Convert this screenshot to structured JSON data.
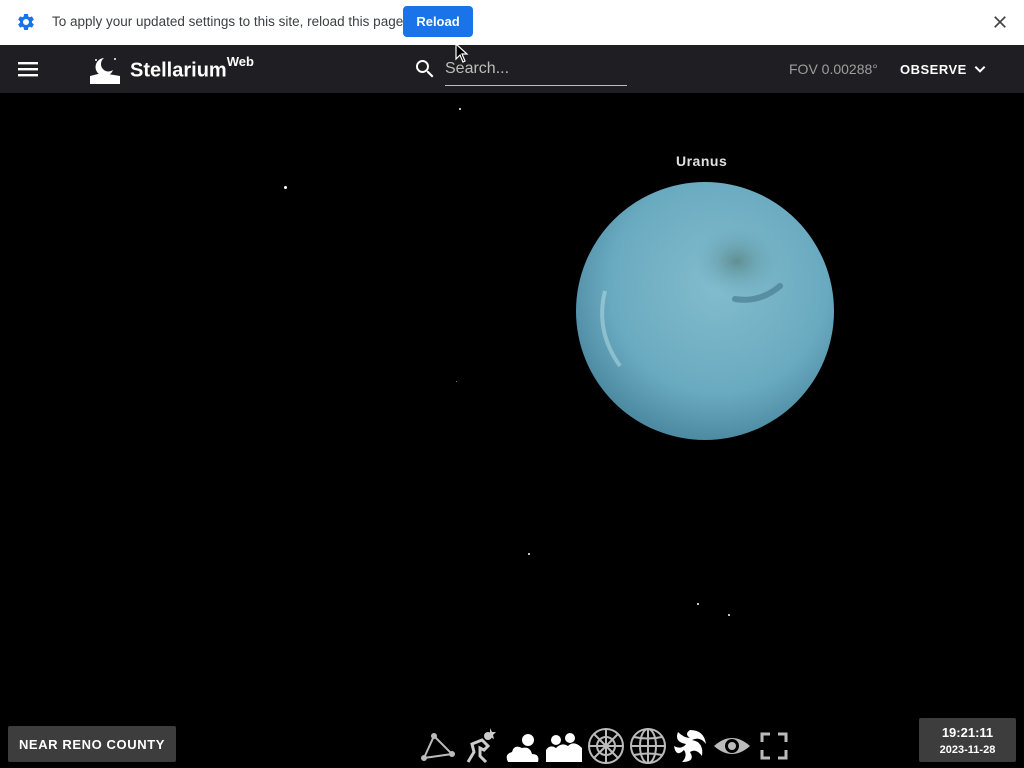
{
  "infobar": {
    "message": "To apply your updated settings to this site, reload this page",
    "reload_label": "Reload",
    "icons": {
      "settings": "gear-icon",
      "close": "close-icon"
    }
  },
  "app": {
    "brand": "Stellarium",
    "brand_sup": "Web",
    "search_placeholder": "Search...",
    "fov": "FOV 0.00288°",
    "observe_label": "OBSERVE"
  },
  "sky": {
    "planet_label": "Uranus"
  },
  "bottom": {
    "location": "NEAR RENO COUNTY",
    "time": "19:21:11",
    "date": "2023-11-28",
    "tools": [
      "constellation-lines-icon",
      "constellation-art-icon",
      "atmosphere-icon",
      "landscape-icon",
      "azimuthal-grid-icon",
      "equatorial-grid-icon",
      "deep-sky-icon",
      "night-mode-icon",
      "fullscreen-icon"
    ]
  },
  "colors": {
    "reload_button": "#1a73e8",
    "topbar": "#212126",
    "planet": "#6fb0c6"
  }
}
